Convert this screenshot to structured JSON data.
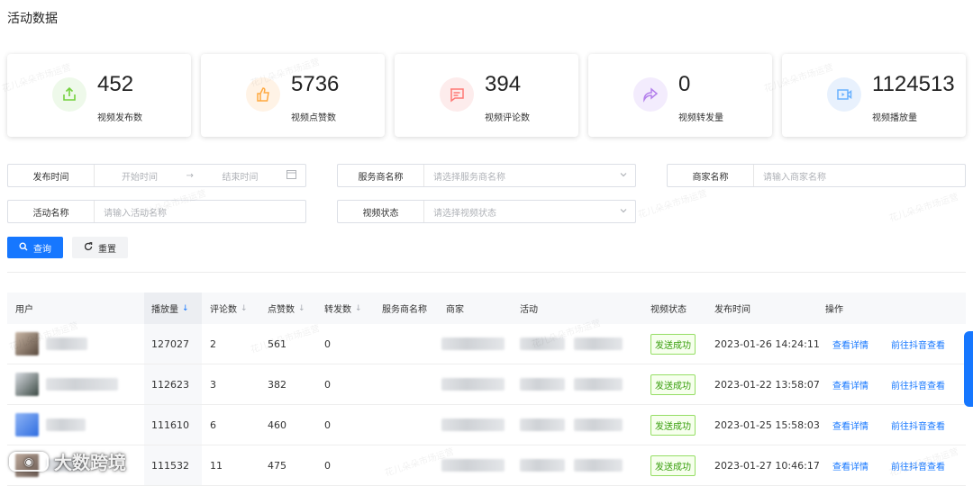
{
  "page": {
    "title": "活动数据"
  },
  "stats": [
    {
      "value": "452",
      "label": "视频发布数",
      "icon": "share-upload-icon",
      "color": "#52c41a",
      "bg": "#eef9ea"
    },
    {
      "value": "5736",
      "label": "视频点赞数",
      "icon": "thumbs-up-icon",
      "color": "#fa8c16",
      "bg": "#fff3e6"
    },
    {
      "value": "394",
      "label": "视频评论数",
      "icon": "comment-icon",
      "color": "#f5222d",
      "bg": "#fdecec"
    },
    {
      "value": "0",
      "label": "视频转发量",
      "icon": "forward-icon",
      "color": "#9254de",
      "bg": "#f3ecfd"
    },
    {
      "value": "1124513",
      "label": "视频播放量",
      "icon": "video-play-icon",
      "color": "#1677ff",
      "bg": "#e8f1fd"
    }
  ],
  "filters": {
    "publish_time": {
      "label": "发布时间",
      "start_placeholder": "开始时间",
      "end_placeholder": "结束时间"
    },
    "provider_name": {
      "label": "服务商名称",
      "placeholder": "请选择服务商名称"
    },
    "merchant_name": {
      "label": "商家名称",
      "placeholder": "请输入商家名称"
    },
    "activity_name": {
      "label": "活动名称",
      "placeholder": "请输入活动名称"
    },
    "video_status": {
      "label": "视频状态",
      "placeholder": "请选择视频状态"
    }
  },
  "buttons": {
    "search": "查询",
    "reset": "重置"
  },
  "table": {
    "columns": {
      "user": "用户",
      "plays": "播放量",
      "comments": "评论数",
      "likes": "点赞数",
      "shares": "转发数",
      "provider": "服务商名称",
      "merchant": "商家",
      "activity": "活动",
      "status": "视频状态",
      "publish_time": "发布时间",
      "actions": "操作"
    },
    "rows": [
      {
        "plays": "127027",
        "comments": "2",
        "likes": "561",
        "shares": "0",
        "status": "发送成功",
        "time": "2023-01-26 14:24:11",
        "action_detail": "查看详情",
        "action_douyin": "前往抖音查看"
      },
      {
        "plays": "112623",
        "comments": "3",
        "likes": "382",
        "shares": "0",
        "status": "发送成功",
        "time": "2023-01-22 13:58:07",
        "action_detail": "查看详情",
        "action_douyin": "前往抖音查看"
      },
      {
        "plays": "111610",
        "comments": "6",
        "likes": "460",
        "shares": "0",
        "status": "发送成功",
        "time": "2023-01-25 15:58:03",
        "action_detail": "查看详情",
        "action_douyin": "前往抖音查看"
      },
      {
        "plays": "111532",
        "comments": "11",
        "likes": "475",
        "shares": "0",
        "status": "发送成功",
        "time": "2023-01-27 10:46:17",
        "action_detail": "查看详情",
        "action_douyin": "前往抖音查看"
      }
    ]
  },
  "watermark": "花儿朵朵市场运营",
  "brand": {
    "name": "大数跨境"
  }
}
